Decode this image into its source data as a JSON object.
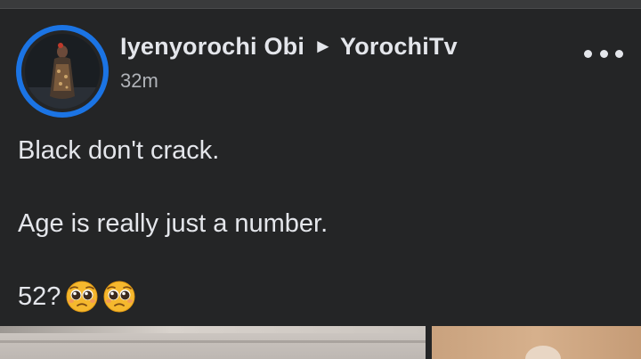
{
  "post": {
    "author": "Iyenyorochi Obi",
    "arrow": "►",
    "page": "YorochiTv",
    "timestamp": "32m",
    "lines": [
      "Black don't crack.",
      "Age is really just a number.",
      "52?"
    ],
    "emojis": [
      "pleading-face-emoji",
      "pleading-face-emoji"
    ]
  },
  "icons": {
    "more": "more-options-icon",
    "avatar_ring_color": "#1b74e4"
  }
}
